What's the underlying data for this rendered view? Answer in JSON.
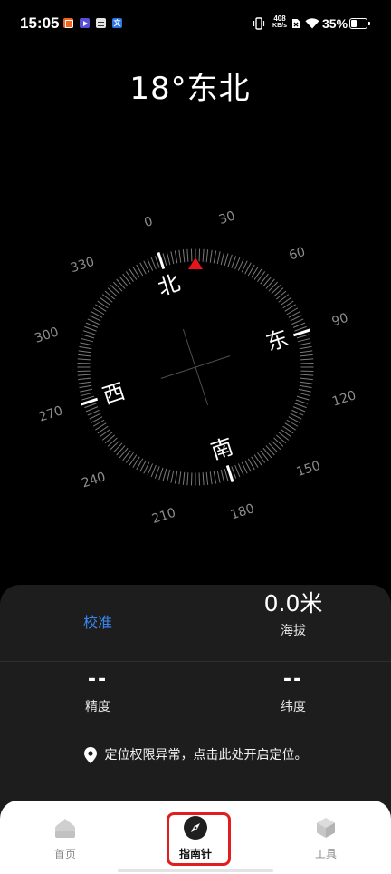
{
  "status_bar": {
    "time": "15:05",
    "notification_icons": [
      {
        "icon": "orange-app-icon",
        "color": "#f0641e"
      },
      {
        "icon": "video-app-icon",
        "color": "#5a4fd8"
      },
      {
        "icon": "gray-app-icon",
        "color": "#e4e4e4"
      },
      {
        "icon": "translate-app-icon",
        "color": "#2f74e6",
        "glyph": "文"
      }
    ],
    "net_speed_value": "408",
    "net_speed_unit": "KB/s",
    "battery": "35%",
    "icons": [
      "vibrate-icon",
      "no-sim-icon",
      "wifi-icon",
      "battery-icon"
    ]
  },
  "heading": {
    "text": "18°东北"
  },
  "compass": {
    "heading_degrees": 18,
    "degree_labels": [
      "0",
      "30",
      "60",
      "90",
      "120",
      "150",
      "180",
      "210",
      "240",
      "270",
      "300",
      "330"
    ],
    "cardinals": [
      "北",
      "东",
      "南",
      "西"
    ]
  },
  "info_panel": {
    "calibrate_label": "校准",
    "altitude": {
      "value": "0.0米",
      "label": "海拔"
    },
    "accuracy": {
      "value": "--",
      "label": "精度"
    },
    "latitude": {
      "value": "--",
      "label": "纬度"
    },
    "location_icon": "location-pin-icon",
    "location_notice": "定位权限异常，点击此处开启定位。"
  },
  "bottom_nav": {
    "items": [
      {
        "label": "首页",
        "icon": "home-icon",
        "active": false
      },
      {
        "label": "指南针",
        "icon": "compass-icon",
        "active": true
      },
      {
        "label": "工具",
        "icon": "tools-cube-icon",
        "active": false
      }
    ]
  },
  "colors": {
    "background": "#000000",
    "panel": "#1d1d1d",
    "accent": "#3a86f0",
    "needle": "#e8141b",
    "highlight": "#e11d1d",
    "nav_background": "#ffffff"
  }
}
